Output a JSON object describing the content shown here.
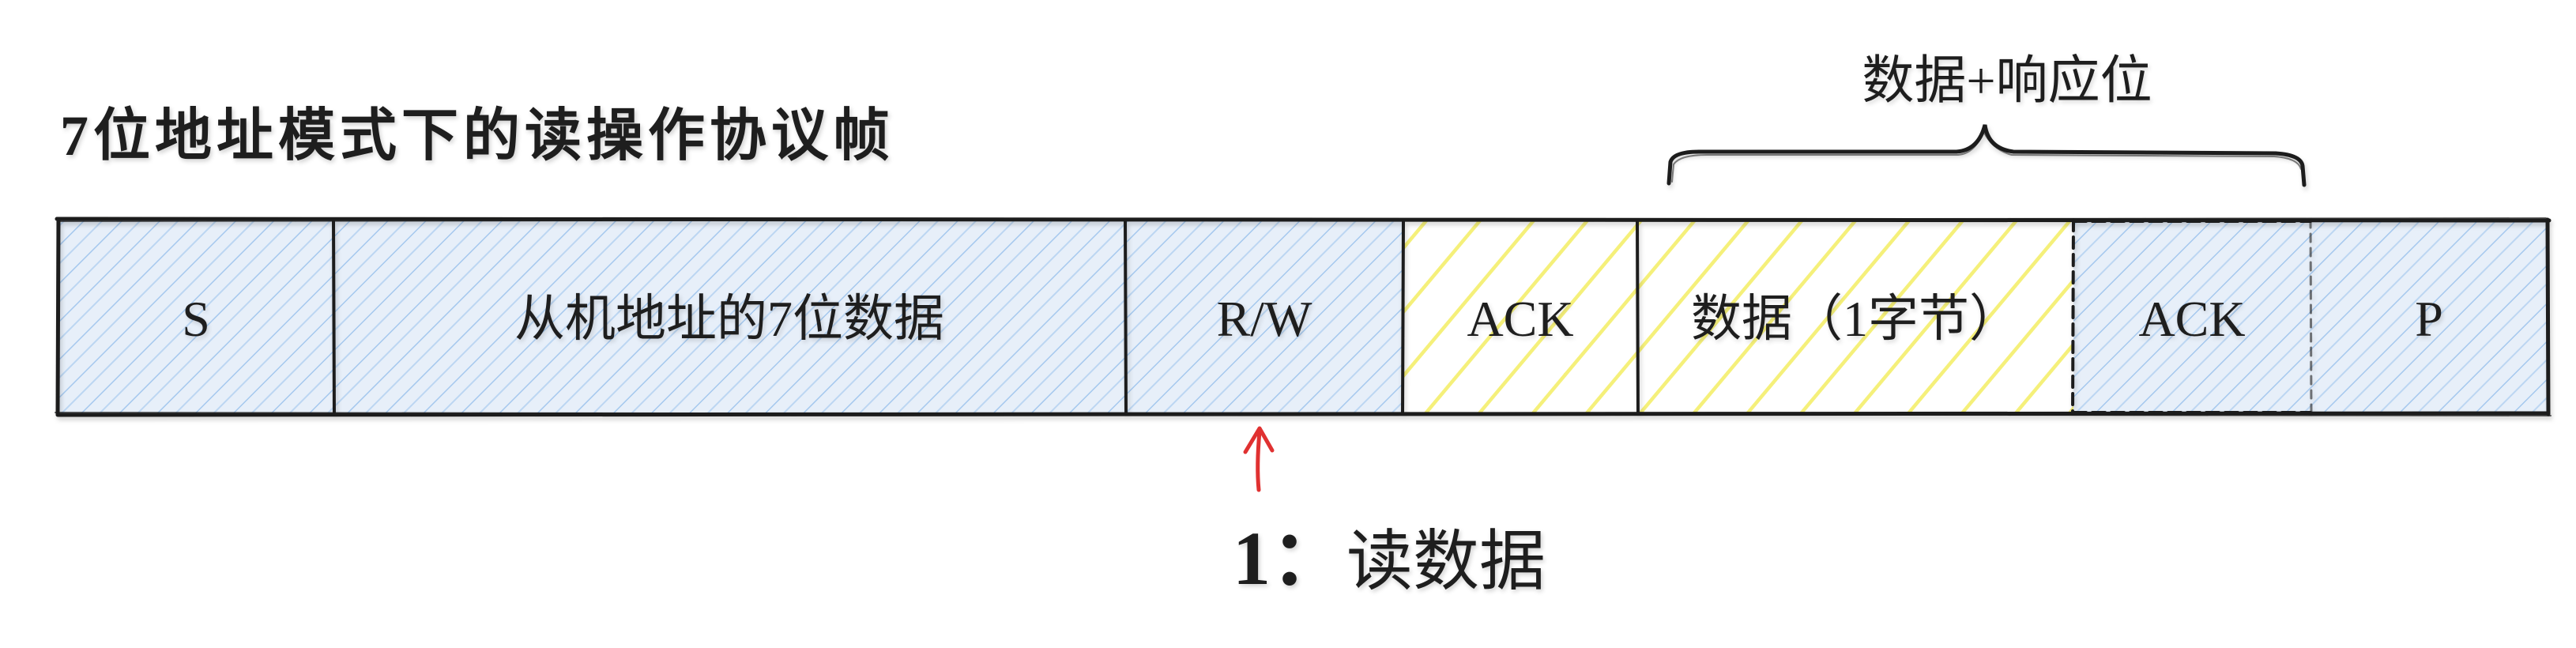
{
  "title": "7位地址模式下的读操作协议帧",
  "brace_label": "数据+响应位",
  "frame": {
    "cells": [
      {
        "key": "start",
        "label": "S",
        "fill": "blue"
      },
      {
        "key": "address",
        "label": "从机地址的7位数据",
        "fill": "blue"
      },
      {
        "key": "rw",
        "label": "R/W",
        "fill": "blue"
      },
      {
        "key": "ack1",
        "label": "ACK",
        "fill": "yellow"
      },
      {
        "key": "data",
        "label": "数据（1字节）",
        "fill": "yellow"
      },
      {
        "key": "ack2",
        "label": "ACK",
        "fill": "blue"
      },
      {
        "key": "stop",
        "label": "P",
        "fill": "blue"
      }
    ]
  },
  "rw_note": {
    "value": "1：",
    "text": "读数据"
  },
  "colors": {
    "outline": "#1e1e1e",
    "blue_hatch": "#a5c8ee",
    "blue_bg": "#e7eff9",
    "yellow_hatch": "#f5f07a",
    "arrow": "#e03131",
    "text": "#1e1e1e"
  }
}
